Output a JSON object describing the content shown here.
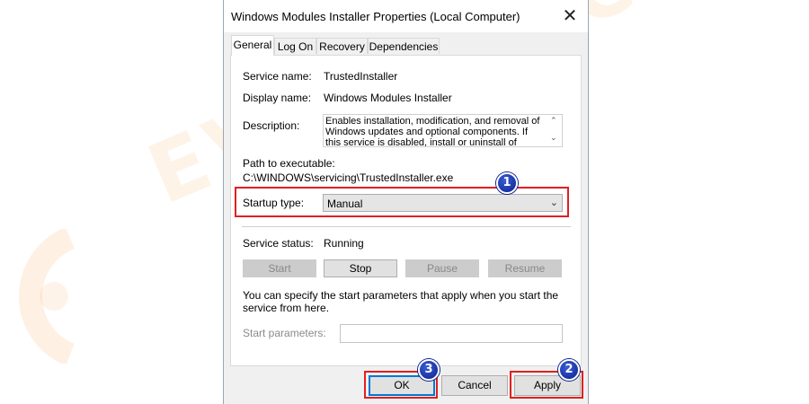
{
  "watermark": {
    "text": "EVILETRICKS"
  },
  "dialog": {
    "title": "Windows Modules Installer Properties (Local Computer)",
    "close_glyph": "✕",
    "tabs": [
      {
        "label": "General",
        "active": true
      },
      {
        "label": "Log On"
      },
      {
        "label": "Recovery"
      },
      {
        "label": "Dependencies"
      }
    ],
    "general": {
      "service_name_label": "Service name:",
      "service_name": "TrustedInstaller",
      "display_name_label": "Display name:",
      "display_name": "Windows Modules Installer",
      "description_label": "Description:",
      "description": "Enables installation, modification, and removal of Windows updates and optional components. If this service is disabled, install or uninstall of Windows",
      "path_label": "Path to executable:",
      "path": "C:\\WINDOWS\\servicing\\TrustedInstaller.exe",
      "startup_type_label": "Startup type:",
      "startup_type": "Manual",
      "service_status_label": "Service status:",
      "service_status": "Running",
      "buttons": {
        "start": "Start",
        "stop": "Stop",
        "pause": "Pause",
        "resume": "Resume"
      },
      "params_hint": "You can specify the start parameters that apply when you start the service from here.",
      "start_params_label": "Start parameters:",
      "start_params_value": ""
    },
    "footer": {
      "ok": "OK",
      "cancel": "Cancel",
      "apply": "Apply"
    }
  },
  "annotations": {
    "badge_1": "1",
    "badge_2": "2",
    "badge_3": "3",
    "highlight_color": "#e02020",
    "badge_color": "#0b1f8a"
  }
}
